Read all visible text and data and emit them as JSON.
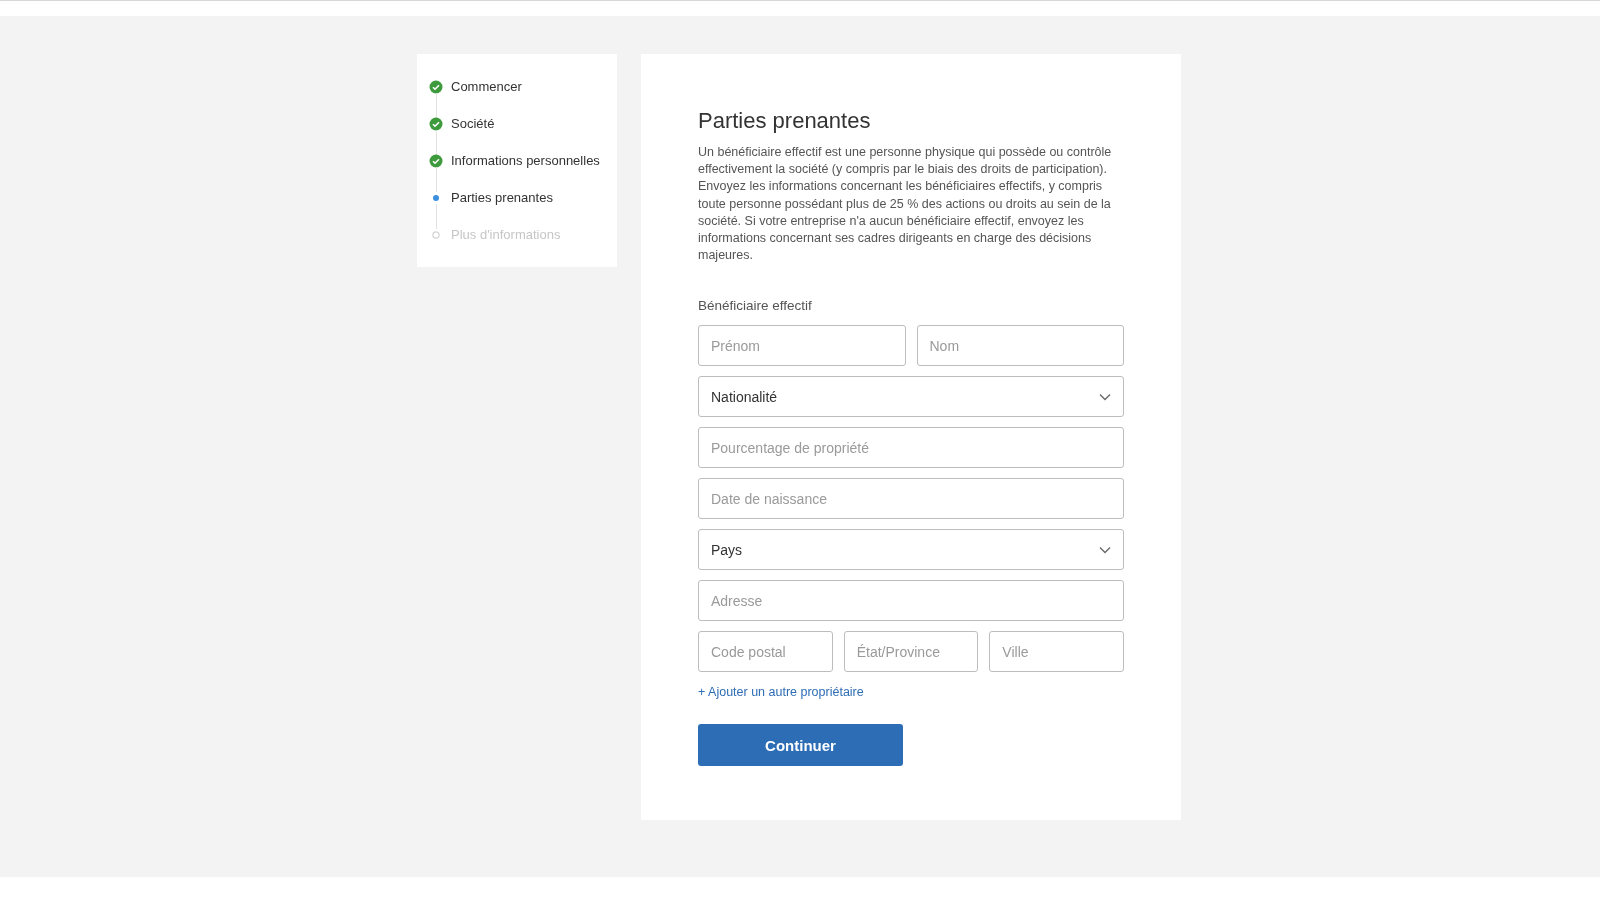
{
  "steps": [
    {
      "label": "Commencer",
      "kind": "done"
    },
    {
      "label": "Société",
      "kind": "done"
    },
    {
      "label": "Informations personnelles",
      "kind": "done"
    },
    {
      "label": "Parties prenantes",
      "kind": "current"
    },
    {
      "label": "Plus d'informations",
      "kind": "pending"
    }
  ],
  "main": {
    "title": "Parties prenantes",
    "description": "Un bénéficiaire effectif est une personne physique qui possède ou contrôle effectivement la société (y compris par le biais des droits de participation). Envoyez les informations concernant les bénéficiaires effectifs, y compris toute personne possédant plus de 25 % des actions ou droits au sein de la société. Si votre entreprise n'a aucun bénéficiaire effectif, envoyez les informations concernant ses cadres dirigeants en charge des décisions majeures.",
    "section_label": "Bénéficiaire effectif",
    "rows": [
      [
        {
          "kind": "text",
          "placeholder": "Prénom"
        },
        {
          "kind": "text",
          "placeholder": "Nom"
        }
      ],
      [
        {
          "kind": "select",
          "value": "Nationalité"
        }
      ],
      [
        {
          "kind": "text",
          "placeholder": "Pourcentage de propriété"
        }
      ],
      [
        {
          "kind": "text",
          "placeholder": "Date de naissance"
        }
      ],
      [
        {
          "kind": "select",
          "value": "Pays"
        }
      ],
      [
        {
          "kind": "text",
          "placeholder": "Adresse"
        }
      ],
      [
        {
          "kind": "text",
          "placeholder": "Code postal"
        },
        {
          "kind": "text",
          "placeholder": "État/Province"
        },
        {
          "kind": "text",
          "placeholder": "Ville"
        }
      ]
    ],
    "add_link": "+ Ajouter un autre propriétaire",
    "submit": "Continuer"
  }
}
